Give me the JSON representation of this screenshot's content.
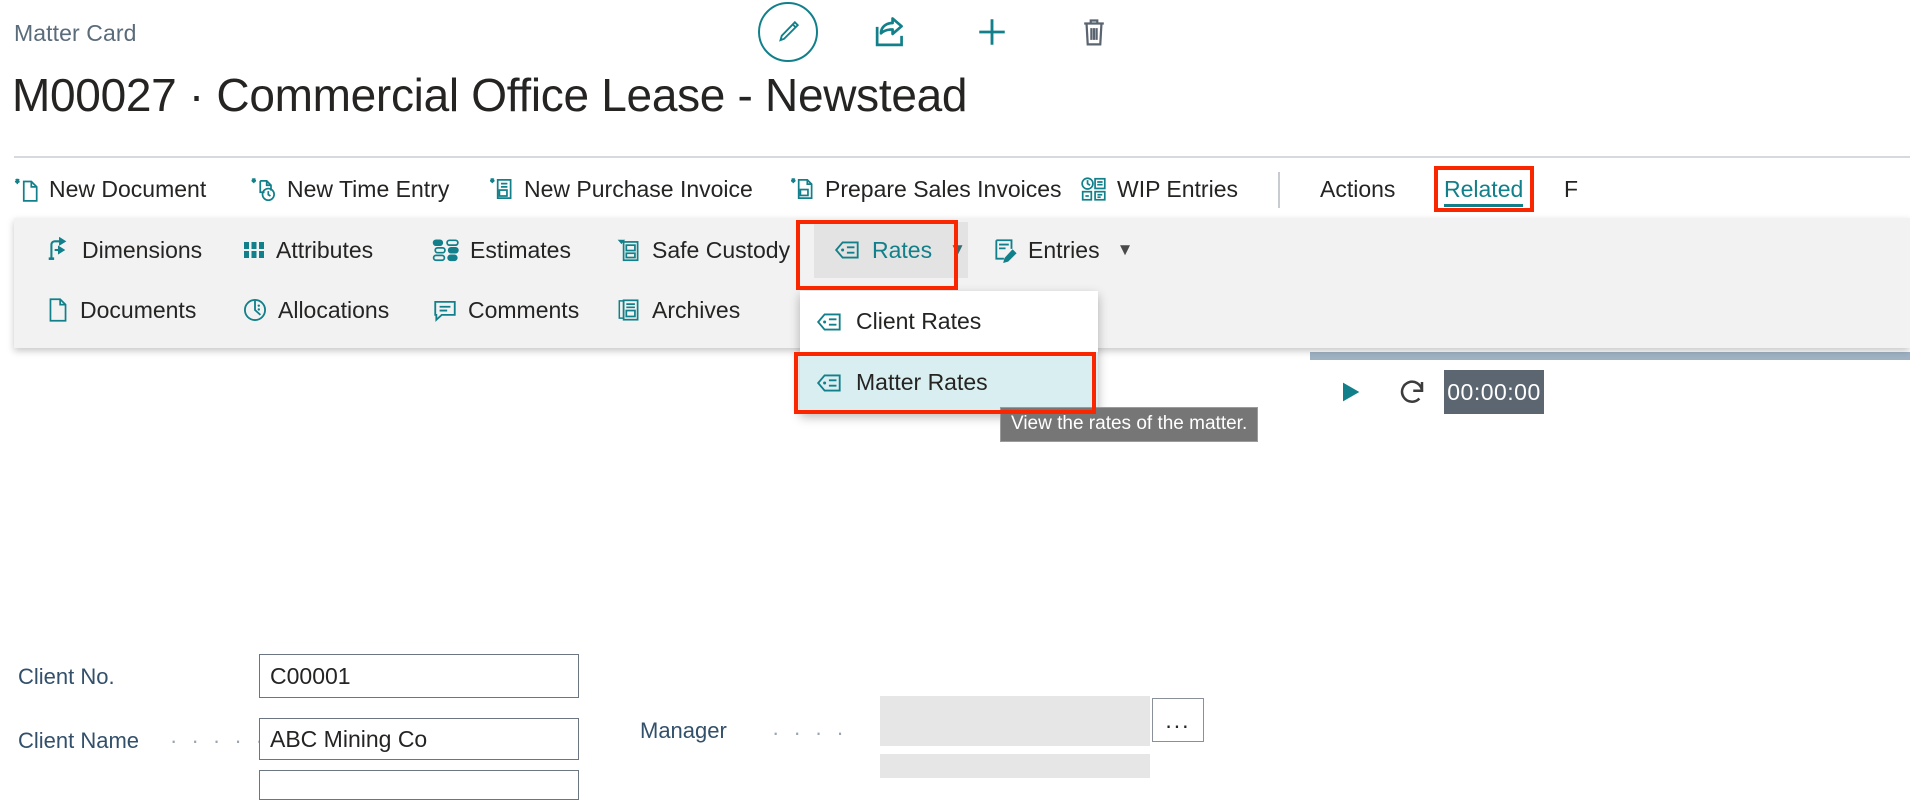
{
  "breadcrumb": "Matter Card",
  "page_title": "M00027 · Commercial Office Lease - Newstead",
  "colors": {
    "accent_teal": "#12808a",
    "highlight_red": "#fa2600",
    "selected_row": "#d9eef0",
    "label_blue": "#33506b",
    "tooltip_grey": "#767676"
  },
  "top_actions": [
    {
      "name": "edit-pencil",
      "icon": "pencil-icon",
      "label": "Edit"
    },
    {
      "name": "share",
      "icon": "share-icon",
      "label": "Share"
    },
    {
      "name": "new",
      "icon": "plus-icon",
      "label": "New"
    },
    {
      "name": "delete",
      "icon": "trash-icon",
      "label": "Delete"
    }
  ],
  "ribbon": {
    "items": [
      {
        "label": "New Document",
        "icon": "new-document-icon"
      },
      {
        "label": "New Time Entry",
        "icon": "new-time-entry-icon"
      },
      {
        "label": "New Purchase Invoice",
        "icon": "new-purchase-invoice-icon"
      },
      {
        "label": "Prepare Sales Invoices",
        "icon": "prepare-sales-invoices-icon"
      },
      {
        "label": "WIP Entries",
        "icon": "wip-entries-icon"
      }
    ],
    "menus": [
      {
        "label": "Actions",
        "active": false
      },
      {
        "label": "Related",
        "active": true
      },
      {
        "label": "F",
        "active": false
      }
    ]
  },
  "related_panel": {
    "row1": [
      {
        "label": "Dimensions",
        "icon": "dimensions-icon"
      },
      {
        "label": "Attributes",
        "icon": "attributes-icon"
      },
      {
        "label": "Estimates",
        "icon": "estimates-icon"
      },
      {
        "label": "Safe Custody",
        "icon": "safe-custody-icon"
      },
      {
        "label": "Rates",
        "icon": "rates-tag-icon",
        "has_chevron": true,
        "expanded": true
      },
      {
        "label": "Entries",
        "icon": "entries-icon",
        "has_chevron": true,
        "expanded": false
      }
    ],
    "row2": [
      {
        "label": "Documents",
        "icon": "documents-icon"
      },
      {
        "label": "Allocations",
        "icon": "allocations-icon"
      },
      {
        "label": "Comments",
        "icon": "comments-icon"
      },
      {
        "label": "Archives",
        "icon": "archives-icon"
      }
    ]
  },
  "rates_submenu": {
    "items": [
      {
        "label": "Client Rates",
        "icon": "rates-tag-icon",
        "selected": false
      },
      {
        "label": "Matter Rates",
        "icon": "rates-tag-icon",
        "selected": true
      }
    ]
  },
  "tooltip": {
    "text": "View the rates of the matter."
  },
  "form": {
    "client_no": {
      "label": "Client No.",
      "value": "C00001",
      "dots": ""
    },
    "client_name": {
      "label": "Client Name",
      "value": "ABC Mining Co",
      "dots": "· · · · · · ·"
    },
    "manager": {
      "label": "Manager",
      "value": "",
      "dots": "· · · ·"
    },
    "ellipsis_button": "..."
  },
  "timer": {
    "play_icon": "play-icon",
    "refresh_icon": "refresh-icon",
    "value": "00:00:00"
  }
}
